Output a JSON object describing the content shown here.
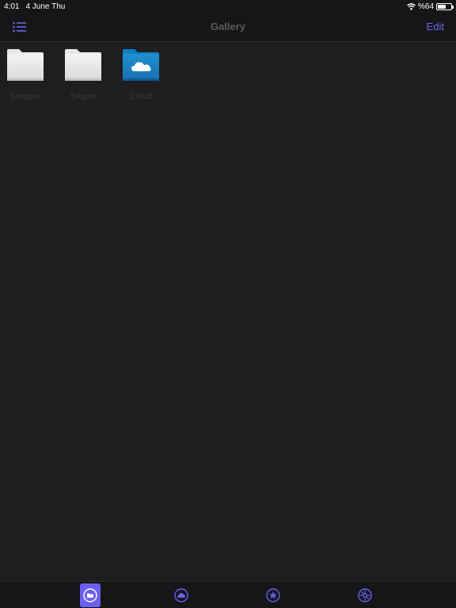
{
  "status_bar": {
    "time": "4:01",
    "date": "4 June Thu",
    "battery_text": "%64",
    "battery_level": 0.64
  },
  "nav": {
    "title": "Gallery",
    "edit_label": "Edit",
    "menu_icon": "list-icon"
  },
  "folders": [
    {
      "label": "Samples",
      "icon": "folder-icon"
    },
    {
      "label": "SAgain",
      "icon": "folder-icon"
    },
    {
      "label": "iCloud",
      "icon": "icloud-folder-icon"
    }
  ],
  "tabs": [
    {
      "icon": "folder-tab-icon",
      "active": true
    },
    {
      "icon": "cloud-tab-icon",
      "active": false
    },
    {
      "icon": "star-tab-icon",
      "active": false
    },
    {
      "icon": "settings-tab-icon",
      "active": false
    }
  ],
  "colors": {
    "accent": "#6a5ff0",
    "background": "#1e1e20",
    "bar": "#161618"
  }
}
